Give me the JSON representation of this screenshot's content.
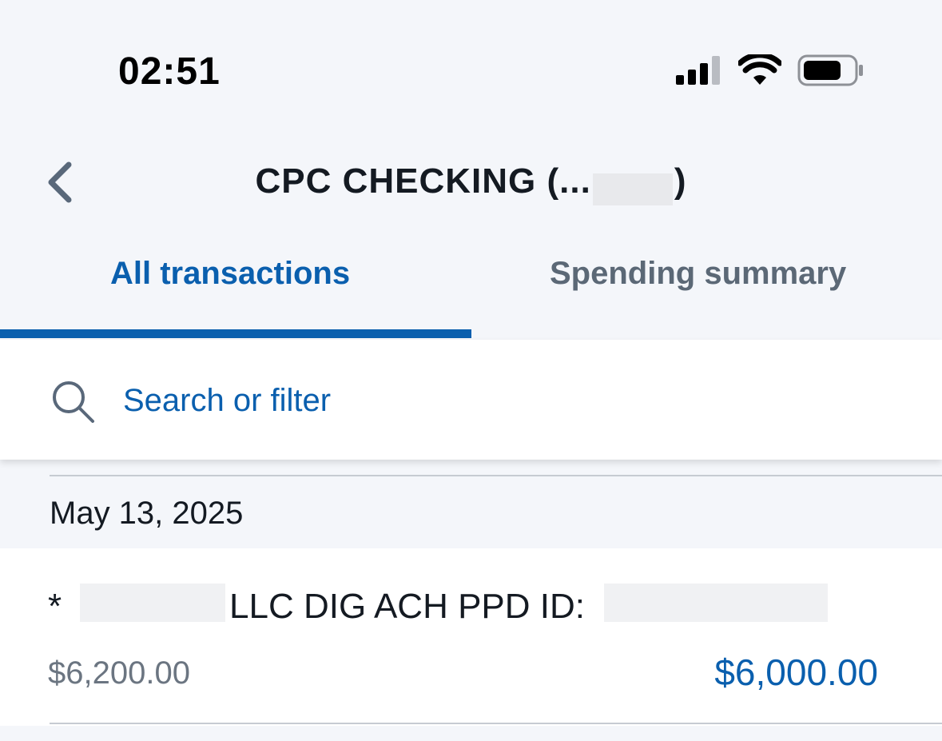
{
  "status_bar": {
    "time": "02:51"
  },
  "header": {
    "title": "CPC CHECKING  (...",
    "title_suffix": ")"
  },
  "tabs": [
    {
      "label": "All transactions",
      "selected": true
    },
    {
      "label": "Spending summary",
      "selected": false
    }
  ],
  "search": {
    "placeholder": "Search or filter"
  },
  "transactions": {
    "date": "May 13, 2025",
    "items": [
      {
        "description_prefix": "*",
        "description_mid": "LLC DIG ACH PPD ID:",
        "balance": "$6,200.00",
        "amount": "$6,000.00"
      }
    ]
  },
  "colors": {
    "accent": "#0a5fae",
    "background": "#f4f6fa",
    "text": "#141a22",
    "muted": "#6b7581"
  }
}
